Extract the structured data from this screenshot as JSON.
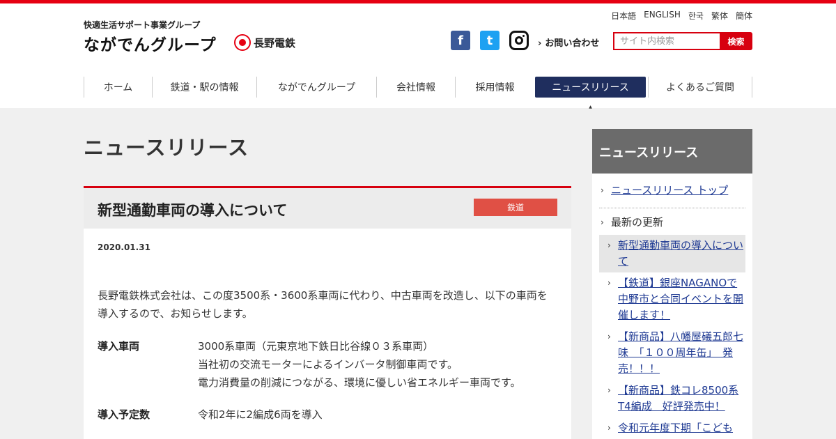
{
  "header": {
    "tagline": "快適生活サポート事業グループ",
    "logo": "ながでんグループ",
    "brand": "長野電鉄",
    "languages": [
      "日本語",
      "ENGLISH",
      "한국",
      "繁体",
      "簡体"
    ],
    "sns": {
      "facebook": "f",
      "twitter": "t"
    },
    "contact": "お問い合わせ",
    "search": {
      "placeholder": "サイト内検索",
      "button": "検索"
    }
  },
  "nav": {
    "items": [
      "ホーム",
      "鉄道・駅の情報",
      "ながでんグループ",
      "会社情報",
      "採用情報",
      "ニュースリリース",
      "よくあるご質問"
    ],
    "active_index": 5,
    "active_color": "#1f2e5e"
  },
  "page": {
    "title": "ニュースリリース"
  },
  "article": {
    "title": "新型通勤車両の導入について",
    "category": "鉄道",
    "date": "2020.01.31",
    "lead": "長野電鉄株式会社は、この度3500系・3600系車両に代わり、中古車両を改造し、以下の車両を導入するので、お知らせします。",
    "details": [
      {
        "label": "導入車両",
        "lines": [
          "3000系車両（元東京地下鉄日比谷線０３系車両）",
          "当社初の交流モーターによるインバータ制御車両です。",
          "電力消費量の削減につながる、環境に優しい省エネルギー車両です。"
        ]
      },
      {
        "label": "導入予定数",
        "lines": [
          "令和2年に2編成6両を導入"
        ]
      }
    ]
  },
  "sidebar": {
    "title": "ニュースリリース",
    "top_link": "ニュースリリース トップ",
    "recent_label": "最新の更新",
    "items": [
      "新型通勤車両の導入について",
      "【鉄道】銀座NAGANOで中野市と合同イベントを開催します！",
      "【新商品】八幡屋礒五郎七味　「１００周年缶」　発売！！！",
      "【新商品】鉄コレ8500系T4編成　好評発売中！",
      "令和元年度下期「こども"
    ]
  },
  "colors": {
    "accent": "#e60012",
    "category": "#e05045",
    "sidebar_head": "#6b6b6b"
  }
}
